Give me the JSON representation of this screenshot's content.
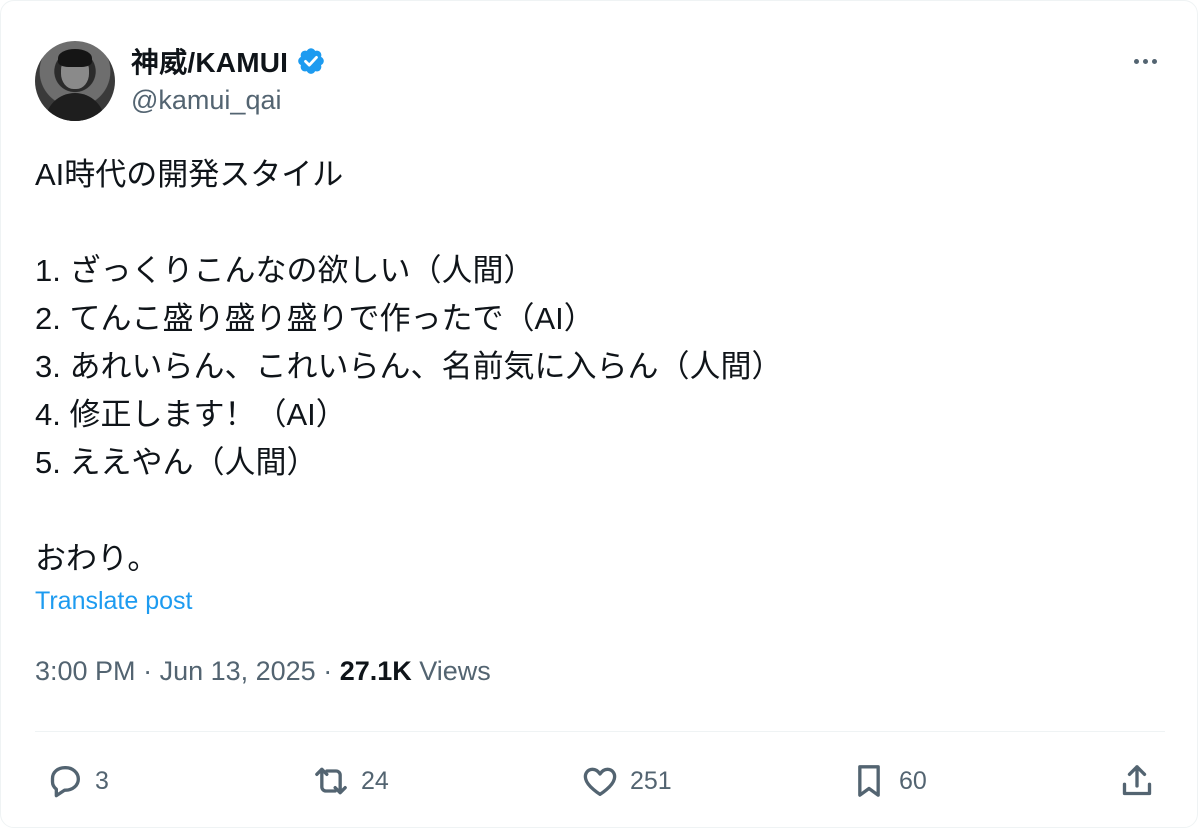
{
  "author": {
    "display_name": "神威/KAMUI",
    "handle": "@kamui_qai",
    "verified": true
  },
  "post": {
    "lines": [
      "AI時代の開発スタイル",
      "",
      "1. ざっくりこんなの欲しい（人間）",
      "2. てんこ盛り盛り盛りで作ったで（AI）",
      "3. あれいらん、これいらん、名前気に入らん（人間）",
      "4. 修正します！（AI）",
      "5. ええやん（人間）",
      "",
      "おわり。"
    ],
    "translate_label": "Translate post"
  },
  "meta": {
    "time": "3:00 PM",
    "separator": " · ",
    "date": "Jun 13, 2025",
    "views_count": "27.1K",
    "views_label": " Views"
  },
  "actions": {
    "replies": "3",
    "reposts": "24",
    "likes": "251",
    "bookmarks": "60"
  },
  "colors": {
    "accent": "#1d9bf0",
    "text": "#0f1419",
    "secondary": "#536471",
    "border": "#eff3f4"
  },
  "icons": [
    "more-icon",
    "verified-icon",
    "reply-icon",
    "repost-icon",
    "like-icon",
    "bookmark-icon",
    "share-icon"
  ]
}
